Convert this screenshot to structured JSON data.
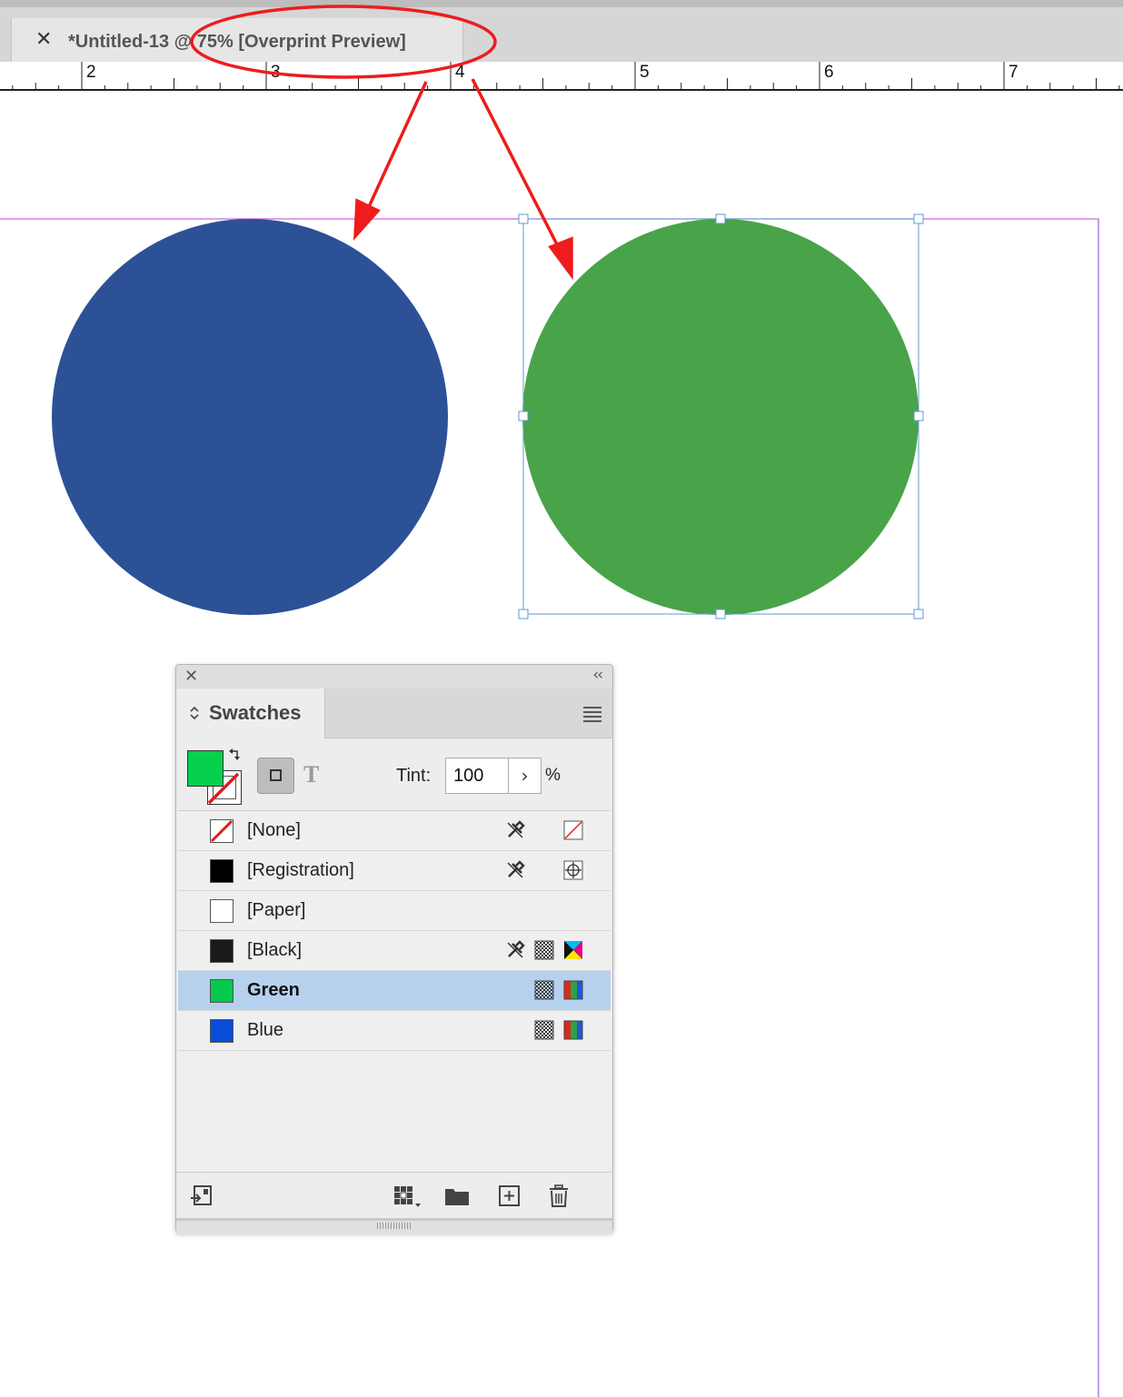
{
  "document_tab": {
    "close_glyph": "✕",
    "title": "*Untitled-13 @ 75% [Overprint Preview]"
  },
  "ruler": {
    "labels": [
      "2",
      "3",
      "4",
      "5",
      "6",
      "7"
    ]
  },
  "canvas": {
    "circles": [
      {
        "name": "blue-circle",
        "color": "#2c5196"
      },
      {
        "name": "green-circle",
        "color": "#49a349",
        "selected": true
      }
    ],
    "annotation_color": "#ee1c1c",
    "margin_guide_color": "#cc66dd",
    "selection_color": "#4a90d9"
  },
  "swatches_panel": {
    "close_glyph": "✕",
    "collapse_glyph": "‹‹",
    "tab_arrows": "⌃⌄",
    "title": "Swatches",
    "fill_color": "#07d04d",
    "text_button": "T",
    "tint_label": "Tint:",
    "tint_value": "100",
    "tint_stepper": "›",
    "tint_unit": "%",
    "swatches": [
      {
        "name": "[None]",
        "color": "none",
        "icons": [
          "no-edit-icon",
          "none-mode-icon"
        ]
      },
      {
        "name": "[Registration]",
        "color": "#000000",
        "icons": [
          "no-edit-icon",
          "registration-mode-icon"
        ]
      },
      {
        "name": "[Paper]",
        "color": "#ffffff",
        "icons": []
      },
      {
        "name": "[Black]",
        "color": "#1a1a1a",
        "icons": [
          "no-edit-icon",
          "process-icon",
          "cmyk-mode-icon"
        ]
      },
      {
        "name": "Green",
        "color": "#07c94c",
        "selected": true,
        "icons": [
          "process-icon",
          "rgb-mode-icon"
        ]
      },
      {
        "name": "Blue",
        "color": "#0a4ed8",
        "icons": [
          "process-icon",
          "rgb-mode-icon"
        ]
      }
    ],
    "bottom_buttons": [
      "place-swatches-icon",
      "show-swatch-kinds-icon",
      "new-color-group-icon",
      "new-swatch-icon",
      "delete-swatch-icon"
    ]
  }
}
